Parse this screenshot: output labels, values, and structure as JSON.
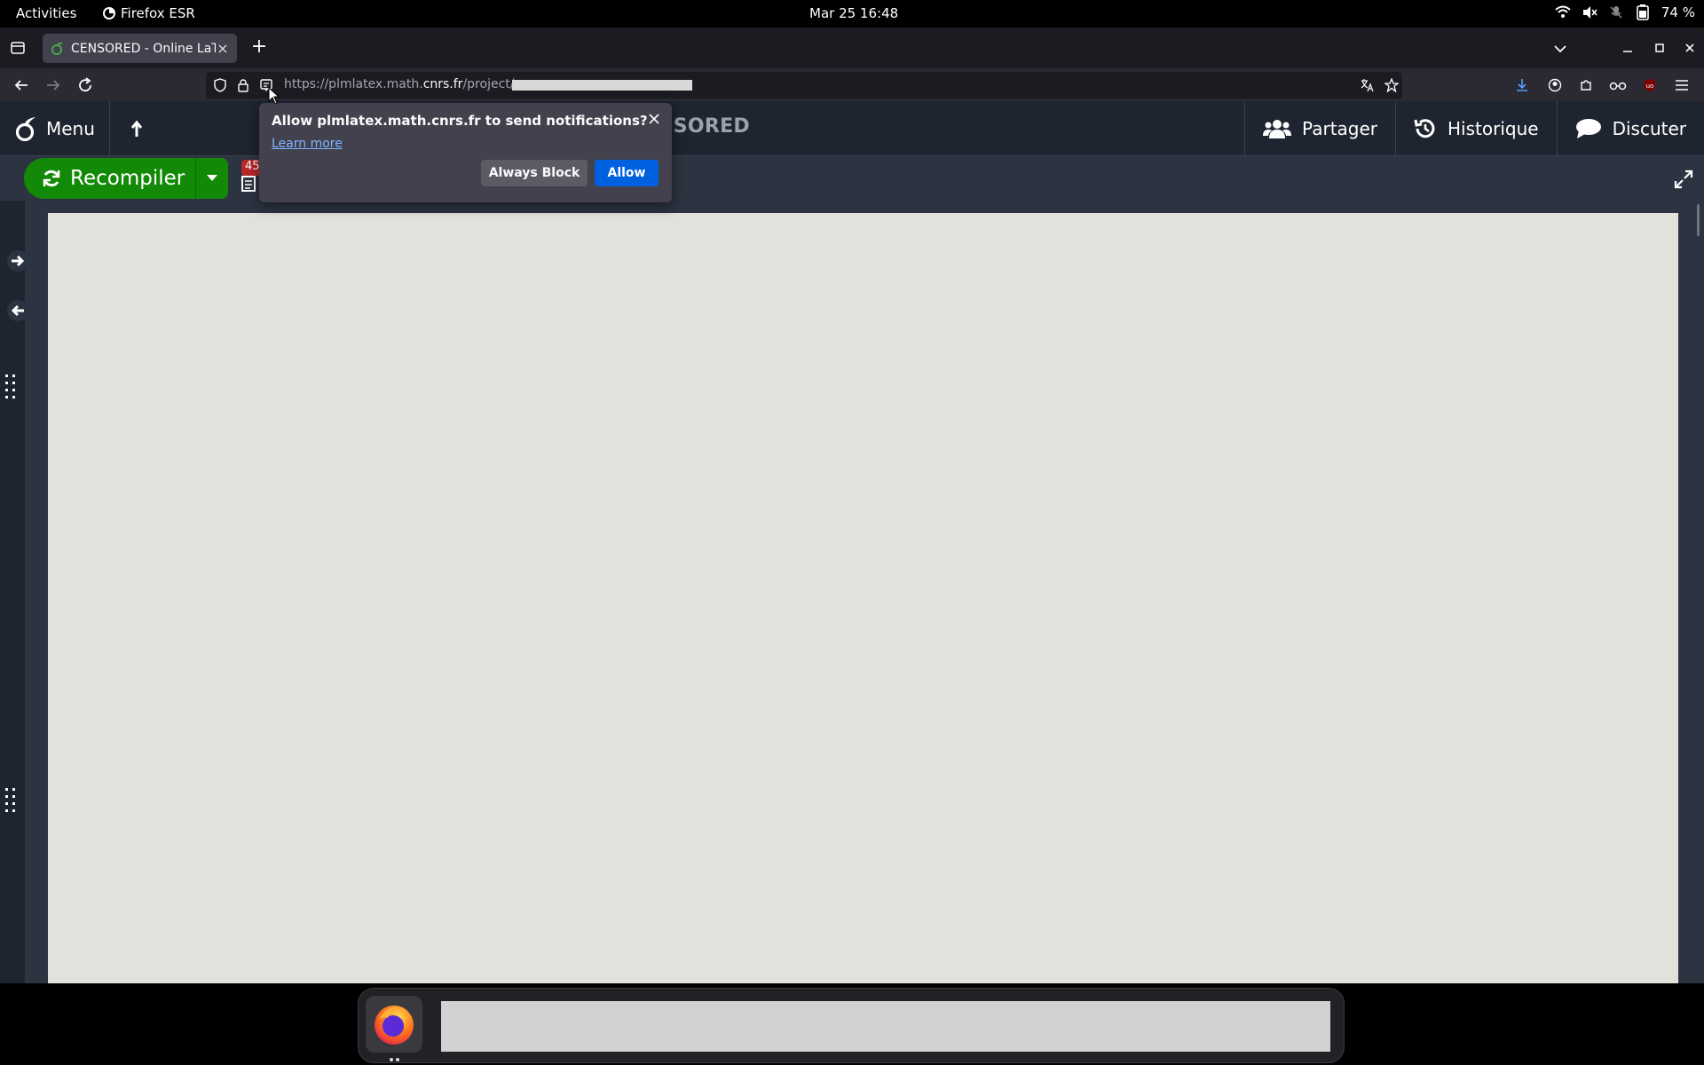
{
  "system_bar": {
    "activities": "Activities",
    "app_name": "Firefox ESR",
    "clock": "Mar 25  16:48",
    "battery": "74 %"
  },
  "browser": {
    "tab_title": "CENSORED - Online LaTe",
    "url_host_prefix": "https://plmlatex.math.",
    "url_host_main": "cnrs.fr",
    "url_path": "/project/"
  },
  "notification": {
    "message": "Allow plmlatex.math.cnrs.fr to send notifications?",
    "learn_more": "Learn more",
    "block_label": "Always Block",
    "allow_label": "Allow"
  },
  "overleaf": {
    "menu_label": "Menu",
    "project_title": "NSORED",
    "share_label": "Partager",
    "history_label": "Historique",
    "chat_label": "Discuter",
    "recompile_label": "Recompiler",
    "log_count": "45"
  },
  "colors": {
    "recompile_green": "#138a07",
    "allow_blue": "#0061e0",
    "header_bg": "#1e2530",
    "pdf_page": "#e2e1dc"
  }
}
